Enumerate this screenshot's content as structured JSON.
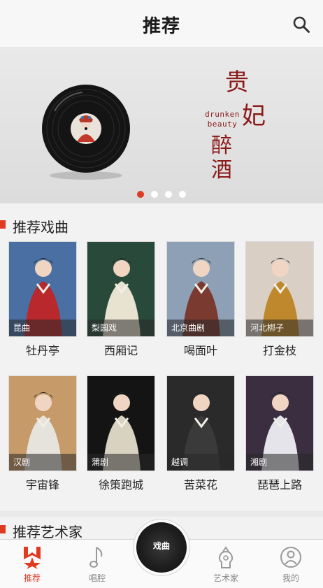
{
  "header": {
    "title": "推荐"
  },
  "banner": {
    "title_chars": [
      "贵",
      "妃",
      "醉",
      "酒"
    ],
    "english": [
      "drunken",
      "beauty"
    ],
    "dots": [
      true,
      false,
      false,
      false
    ]
  },
  "sections": {
    "opera_title": "推荐戏曲",
    "artist_title": "推荐艺术家"
  },
  "operas": [
    {
      "tag": "昆曲",
      "name": "牡丹亭",
      "bg": "#4a6fa3",
      "fg": "#b8282c"
    },
    {
      "tag": "梨园戏",
      "name": "西厢记",
      "bg": "#294a3a",
      "fg": "#e8e2d0"
    },
    {
      "tag": "北京曲剧",
      "name": "喝面叶",
      "bg": "#8da0b5",
      "fg": "#7a3a30"
    },
    {
      "tag": "河北梆子",
      "name": "打金枝",
      "bg": "#d9cfc4",
      "fg": "#c0882c"
    },
    {
      "tag": "汉剧",
      "name": "宇宙锋",
      "bg": "#c79a6a",
      "fg": "#e6e2dc"
    },
    {
      "tag": "蒲剧",
      "name": "徐策跑城",
      "bg": "#141414",
      "fg": "#d8d2c0"
    },
    {
      "tag": "越调",
      "name": "苦菜花",
      "bg": "#2a2a2a",
      "fg": "#3a3a3a"
    },
    {
      "tag": "湘剧",
      "name": "琵琶上路",
      "bg": "#3a2e40",
      "fg": "#e4e4ea"
    }
  ],
  "tabs": [
    {
      "label": "推荐",
      "icon": "recommend-icon",
      "active": true
    },
    {
      "label": "唱腔",
      "icon": "music-note-icon",
      "active": false
    },
    {
      "label": "艺术家",
      "icon": "artist-icon",
      "active": false
    },
    {
      "label": "我的",
      "icon": "profile-icon",
      "active": false
    }
  ],
  "center_button": {
    "label": "戏曲"
  },
  "colors": {
    "accent": "#e03a22",
    "banner_text": "#8b1a1a"
  }
}
